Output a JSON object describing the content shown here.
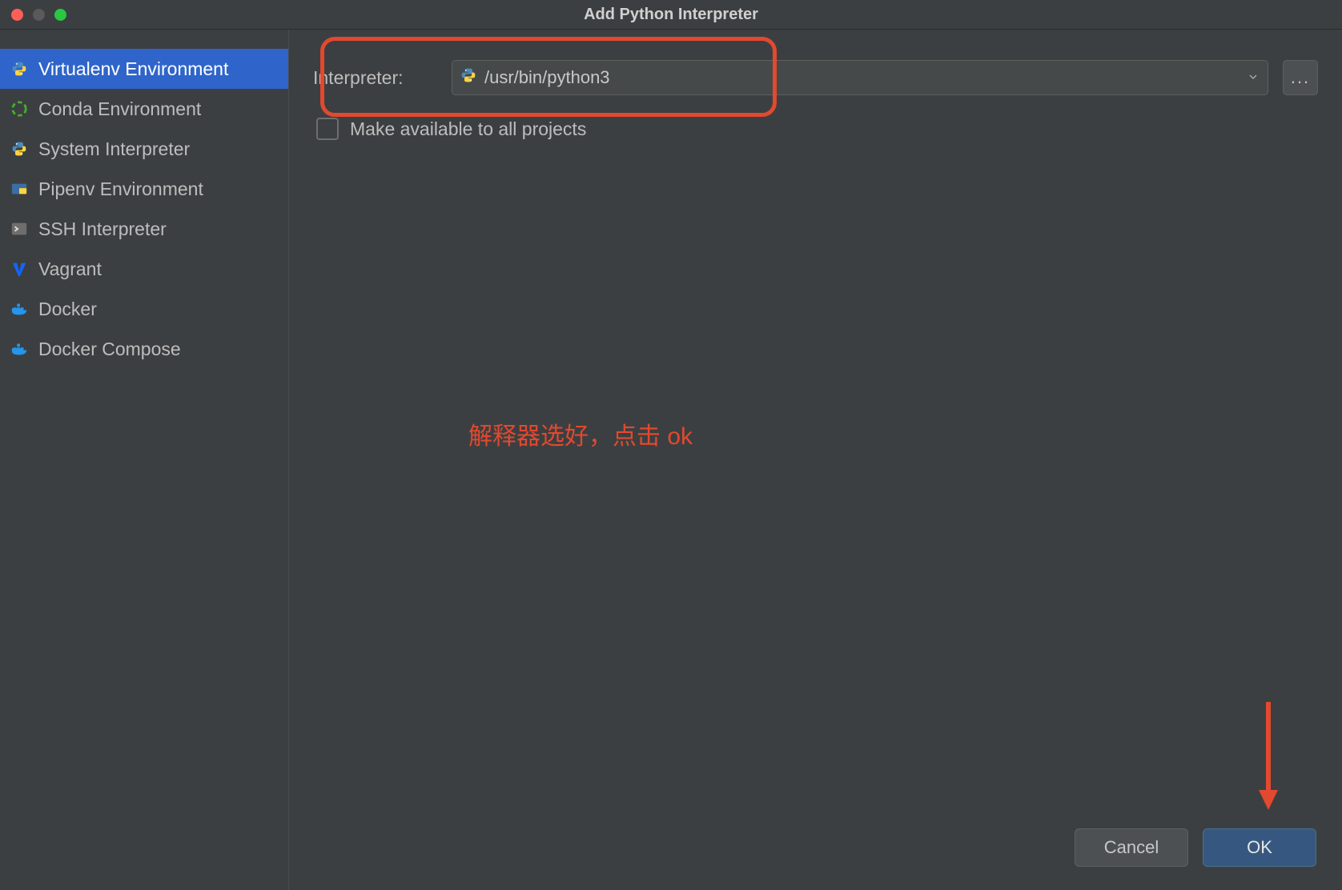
{
  "title": "Add Python Interpreter",
  "sidebar": {
    "items": [
      {
        "label": "Virtualenv Environment",
        "icon": "python-icon",
        "selected": true
      },
      {
        "label": "Conda Environment",
        "icon": "conda-icon",
        "selected": false
      },
      {
        "label": "System Interpreter",
        "icon": "python-icon",
        "selected": false
      },
      {
        "label": "Pipenv Environment",
        "icon": "pipenv-icon",
        "selected": false
      },
      {
        "label": "SSH Interpreter",
        "icon": "ssh-icon",
        "selected": false
      },
      {
        "label": "Vagrant",
        "icon": "vagrant-icon",
        "selected": false
      },
      {
        "label": "Docker",
        "icon": "docker-icon",
        "selected": false
      },
      {
        "label": "Docker Compose",
        "icon": "docker-icon",
        "selected": false
      }
    ]
  },
  "form": {
    "interpreter_label": "Interpreter:",
    "interpreter_value": "/usr/bin/python3",
    "make_available_label": "Make available to all projects",
    "make_available_checked": false,
    "more_button": "..."
  },
  "annotation": {
    "text": "解释器选好，点击 ok"
  },
  "buttons": {
    "cancel": "Cancel",
    "ok": "OK"
  }
}
